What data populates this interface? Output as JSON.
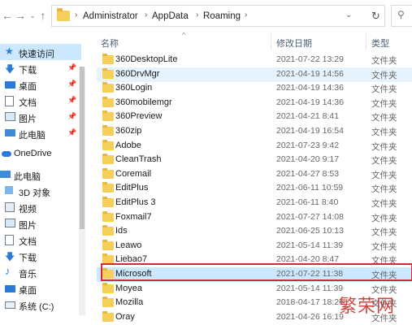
{
  "address": {
    "crumbs": [
      "Administrator",
      "AppData",
      "Roaming"
    ]
  },
  "sidebar": {
    "items": [
      {
        "label": "快速访问",
        "icon": "star-icon"
      },
      {
        "label": "下载",
        "icon": "download-icon"
      },
      {
        "label": "桌面",
        "icon": "desktop-icon"
      },
      {
        "label": "文档",
        "icon": "document-icon"
      },
      {
        "label": "图片",
        "icon": "picture-icon"
      },
      {
        "label": "此电脑",
        "icon": "computer-icon"
      },
      {
        "label": "OneDrive",
        "icon": "cloud-icon"
      },
      {
        "label": "此电脑",
        "icon": "computer-icon"
      },
      {
        "label": "3D 对象",
        "icon": "cube-icon"
      },
      {
        "label": "视频",
        "icon": "video-icon"
      },
      {
        "label": "图片",
        "icon": "picture-icon"
      },
      {
        "label": "文档",
        "icon": "document-icon"
      },
      {
        "label": "下载",
        "icon": "download-icon"
      },
      {
        "label": "音乐",
        "icon": "music-icon"
      },
      {
        "label": "桌面",
        "icon": "desktop-icon"
      },
      {
        "label": "系统 (C:)",
        "icon": "drive-icon"
      }
    ]
  },
  "columns": {
    "name": "名称",
    "date": "修改日期",
    "type": "类型"
  },
  "files": [
    {
      "name": "360DesktopLite",
      "date": "2021-07-22 13:29",
      "type": "文件夹"
    },
    {
      "name": "360DrvMgr",
      "date": "2021-04-19 14:56",
      "type": "文件夹"
    },
    {
      "name": "360Login",
      "date": "2021-04-19 14:36",
      "type": "文件夹"
    },
    {
      "name": "360mobilemgr",
      "date": "2021-04-19 14:36",
      "type": "文件夹"
    },
    {
      "name": "360Preview",
      "date": "2021-04-21 8:41",
      "type": "文件夹"
    },
    {
      "name": "360zip",
      "date": "2021-04-19 16:54",
      "type": "文件夹"
    },
    {
      "name": "Adobe",
      "date": "2021-07-23 9:42",
      "type": "文件夹"
    },
    {
      "name": "CleanTrash",
      "date": "2021-04-20 9:17",
      "type": "文件夹"
    },
    {
      "name": "Coremail",
      "date": "2021-04-27 8:53",
      "type": "文件夹"
    },
    {
      "name": "EditPlus",
      "date": "2021-06-11 10:59",
      "type": "文件夹"
    },
    {
      "name": "EditPlus 3",
      "date": "2021-06-11 8:40",
      "type": "文件夹"
    },
    {
      "name": "Foxmail7",
      "date": "2021-07-27 14:08",
      "type": "文件夹"
    },
    {
      "name": "Ids",
      "date": "2021-06-25 10:13",
      "type": "文件夹"
    },
    {
      "name": "Leawo",
      "date": "2021-05-14 11:39",
      "type": "文件夹"
    },
    {
      "name": "Liebao7",
      "date": "2021-04-20 8:47",
      "type": "文件夹"
    },
    {
      "name": "Microsoft",
      "date": "2021-07-22 11:38",
      "type": "文件夹"
    },
    {
      "name": "Moyea",
      "date": "2021-05-14 11:39",
      "type": "文件夹"
    },
    {
      "name": "Mozilla",
      "date": "2018-04-17 18:26",
      "type": "文件夹"
    },
    {
      "name": "Oray",
      "date": "2021-04-26 16:19",
      "type": "文件夹"
    }
  ],
  "watermark": "繁荣网",
  "colors": {
    "selected": "#cce8ff",
    "hover": "#e5f3ff",
    "highlight": "#d9263b",
    "folder": "#f6cf5b"
  }
}
